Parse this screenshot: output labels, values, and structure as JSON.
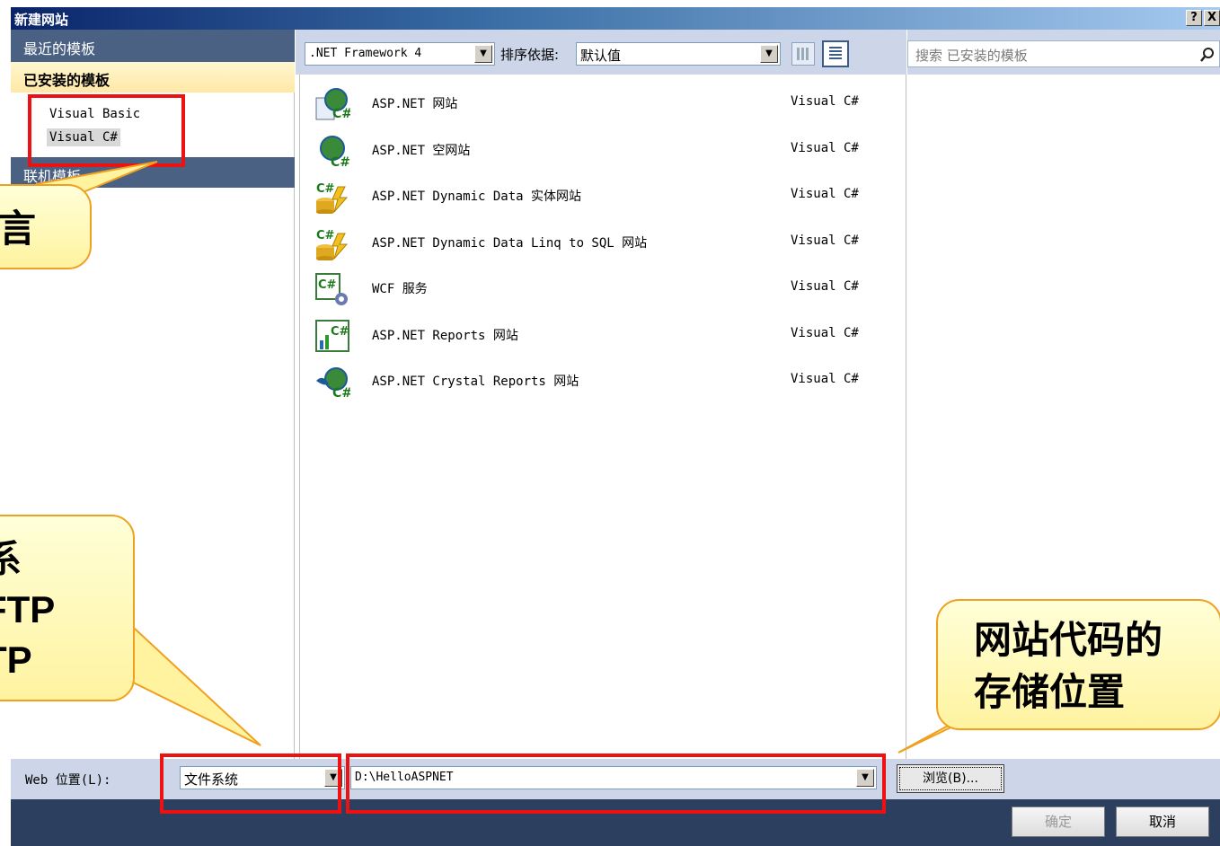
{
  "window": {
    "title": "新建网站",
    "help_label": "?",
    "close_label": "X"
  },
  "left_panel": {
    "recent": "最近的模板",
    "installed": "已安装的模板",
    "languages": [
      "Visual Basic",
      "Visual C#"
    ],
    "online": "联机模板"
  },
  "toolbar": {
    "framework": ".NET Framework 4",
    "sort_label": "排序依据:",
    "sort_value": "默认值"
  },
  "search": {
    "placeholder": "搜索 已安装的模板"
  },
  "templates": [
    {
      "name": "ASP.NET 网站",
      "lang": "Visual C#"
    },
    {
      "name": "ASP.NET 空网站",
      "lang": "Visual C#"
    },
    {
      "name": "ASP.NET Dynamic Data 实体网站",
      "lang": "Visual C#"
    },
    {
      "name": "ASP.NET Dynamic Data Linq to SQL 网站",
      "lang": "Visual C#"
    },
    {
      "name": "WCF 服务",
      "lang": "Visual C#"
    },
    {
      "name": "ASP.NET Reports 网站",
      "lang": "Visual C#"
    },
    {
      "name": "ASP.NET Crystal Reports 网站",
      "lang": "Visual C#"
    }
  ],
  "location": {
    "label": "Web 位置(L):",
    "type": "文件系统",
    "path": "D:\\HelloASPNET",
    "browse": "浏览(B)..."
  },
  "buttons": {
    "ok": "确定",
    "cancel": "取消"
  },
  "callouts": {
    "language": "言",
    "location_type": [
      "系",
      "FTP",
      "TP"
    ],
    "storage": [
      "网站代码的",
      "存储位置"
    ]
  },
  "colors": {
    "highlight": "#ee1111",
    "callout_fill": "#fff3a0",
    "callout_border": "#f0a020",
    "panel_header": "#4a6184"
  }
}
